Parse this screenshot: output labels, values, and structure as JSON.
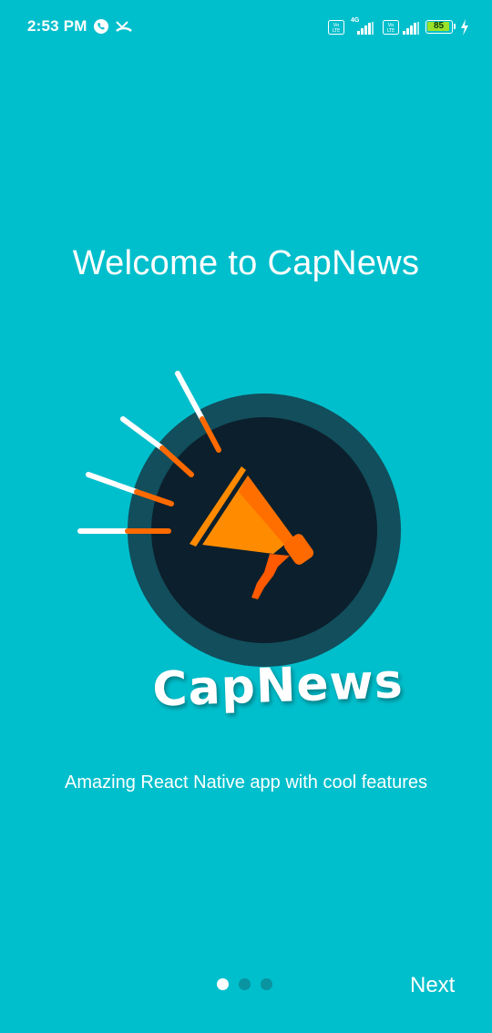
{
  "status_bar": {
    "time": "2:53 PM",
    "battery": "85",
    "network_1": "4G",
    "volte_label": "Vo LTE"
  },
  "welcome": {
    "title": "Welcome to CapNews"
  },
  "logo": {
    "wordmark": "CapNews",
    "icon": "megaphone-icon",
    "colors": {
      "outer_ring": "#124e5c",
      "inner_circle": "#0c1f2c",
      "megaphone_orange": "#ff7a00",
      "rays": "#ffffff"
    }
  },
  "tagline": "Amazing React Native app with cool features",
  "pagination": {
    "total": 3,
    "active_index": 0
  },
  "next_label": "Next",
  "colors": {
    "background": "#00bfcc",
    "dot_inactive": "#0a93a0",
    "dot_active": "#ffffff"
  }
}
